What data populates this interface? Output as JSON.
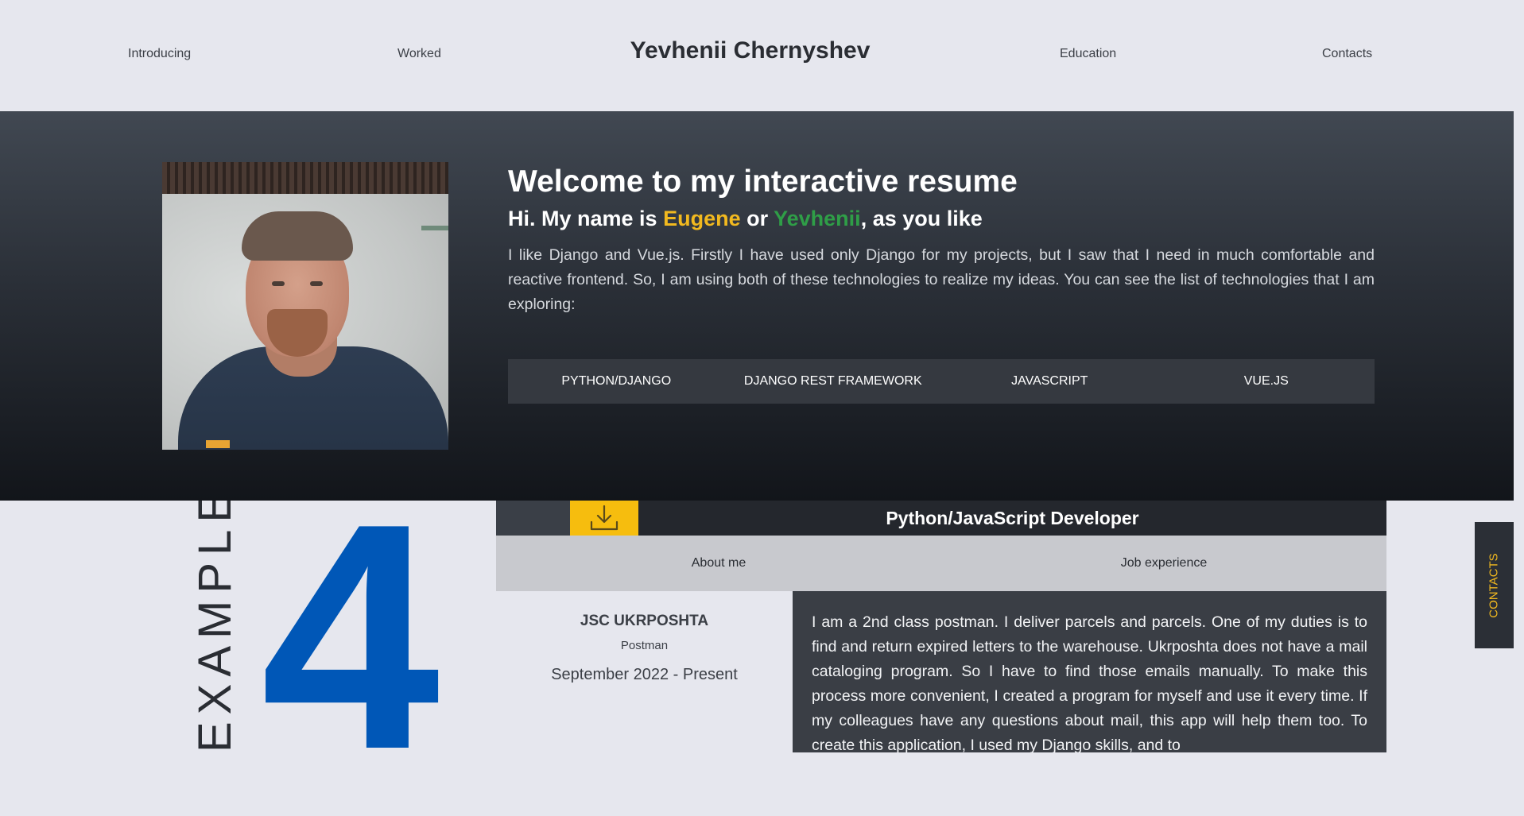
{
  "nav": {
    "site_title": "Yevhenii Chernyshev",
    "links": [
      "Introducing",
      "Worked",
      "Education",
      "Contacts"
    ]
  },
  "hero": {
    "heading": "Welcome to my interactive resume",
    "greeting_prefix": "Hi. My name is ",
    "name_1": "Eugene",
    "name_joiner": " or ",
    "name_2": "Yevhenii",
    "greeting_suffix": ", as you like",
    "description": "I like Django and Vue.js. Firstly I have used only Django for my projects, but I saw that I need in much comfortable and reactive frontend. So, I am using both of these technologies to realize my ideas. You can see the list of technologies that I am exploring:",
    "technologies": [
      "PYTHON/DJANGO",
      "DJANGO REST FRAMEWORK",
      "JAVASCRIPT",
      "VUE.JS"
    ]
  },
  "examples": {
    "count": "4",
    "label": "EXAMPLES"
  },
  "resume": {
    "title": "Python/JavaScript Developer",
    "download_icon": "download-icon",
    "tabs": [
      "About me",
      "Job experience"
    ],
    "job": {
      "company": "JSC UKRPOSHTA",
      "role": "Postman",
      "dates": "September 2022 - Present",
      "description": "I am a 2nd class postman. I deliver parcels and parcels. One of my duties is to find and return expired letters to the warehouse. Ukrposhta does not have a mail cataloging program. So I have to find those emails manually. To make this process more convenient, I created a program for myself and use it every time. If my colleagues have any questions about mail, this app will help them too. To create this application, I used my Django skills, and to"
    }
  },
  "side_tab": {
    "label": "CONTACTS"
  },
  "colors": {
    "accent_yellow": "#f2b91f",
    "accent_green": "#2f9e47",
    "accent_blue": "#0057b7",
    "download_button": "#f6bd0e"
  }
}
